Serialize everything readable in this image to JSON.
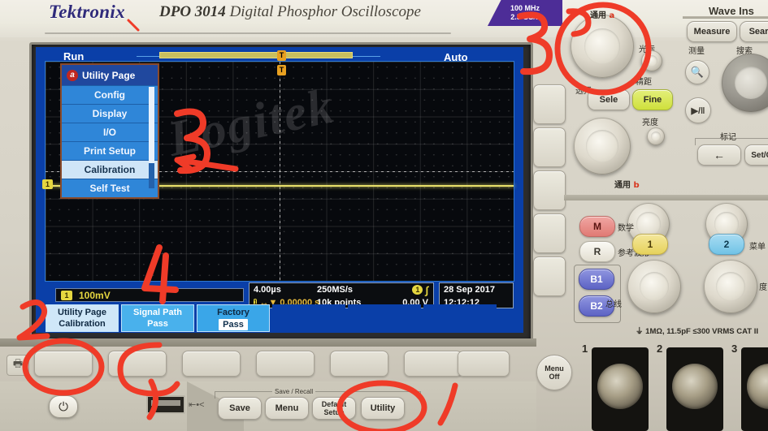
{
  "device": {
    "brand": "Tektronix",
    "model": "DPO 3014",
    "model_sub": "Digital Phosphor Oscilloscope",
    "badge_line1": "100 MHz",
    "badge_line2": "2.5 GS/s",
    "input_spec": "1MΩ, 11.5pF ≤300 VRMS CAT II"
  },
  "screen": {
    "acq_state": "Run",
    "trigger_mode": "Auto",
    "trigger_marker": "T",
    "channel_marker": "1",
    "menu": {
      "title": "Utility Page",
      "title_badge": "a",
      "items": [
        {
          "label": "Config",
          "selected": false
        },
        {
          "label": "Display",
          "selected": false
        },
        {
          "label": "I/O",
          "selected": false
        },
        {
          "label": "Print Setup",
          "selected": false
        },
        {
          "label": "Calibration",
          "selected": true
        },
        {
          "label": "Self Test",
          "selected": false
        }
      ]
    },
    "channel_readout": {
      "badge": "1",
      "scale": "100mV"
    },
    "status": {
      "timebase": "4.00µs",
      "delay_badge": "1",
      "delay": "0.00000 s",
      "sample_rate": "250MS/s",
      "record_length": "10k points",
      "trigger_source": "1",
      "trigger_level": "0.00 V",
      "date": "28 Sep  2017",
      "time": "12:12:12"
    },
    "softkeys": [
      {
        "line1": "Utility Page",
        "line2": "Calibration",
        "style": "light"
      },
      {
        "line1": "Signal Path",
        "line2": "Pass",
        "style": "mid"
      },
      {
        "line1": "Factory",
        "line2": "Pass",
        "style": "plain"
      }
    ]
  },
  "annotations": [
    {
      "id": "ann-1",
      "label": "1"
    },
    {
      "id": "ann-2",
      "label": "2"
    },
    {
      "id": "ann-3-top",
      "label": "3"
    },
    {
      "id": "ann-3-screen",
      "label": "3"
    },
    {
      "id": "ann-4",
      "label": "4"
    }
  ],
  "panel": {
    "wave_inspector_title": "Wave Ins",
    "buttons": {
      "measure": "Measure",
      "measure_cn": "测量",
      "search": "Sear",
      "search_cn": "搜索",
      "select": "Sele",
      "select_cn": "选择",
      "fine": "Fine",
      "fine_cn": "精距",
      "cursor_cn": "光标",
      "intensity_cn": "亮度",
      "general_cn": "通用",
      "general_badge": "b",
      "mark_cn": "标记",
      "set_clear": "Set/C",
      "menu_off_l1": "Menu",
      "menu_off_l2": "Off",
      "save_recall_group": "Save / Recall",
      "save": "Save",
      "menu": "Menu",
      "default_l1": "Default",
      "default_l2": "Setup",
      "utility": "Utility"
    },
    "channel_keys": [
      {
        "label": "M",
        "cn": "数学"
      },
      {
        "label": "R",
        "cn": "参考波形"
      },
      {
        "label": "B1",
        "cn": ""
      },
      {
        "label": "B2",
        "cn": "总线"
      },
      {
        "label": "1",
        "cn": ""
      },
      {
        "label": "2",
        "cn": ""
      }
    ],
    "bnc_labels": [
      "1",
      "2",
      "3"
    ]
  },
  "colors": {
    "screen_blue": "#0a3fa8",
    "menu_blue": "#2f86d8",
    "trace_yellow": "#e5d640",
    "annotation_red": "#ef3b28",
    "badge_purple": "#4d2d97"
  },
  "watermark": "Logitek"
}
